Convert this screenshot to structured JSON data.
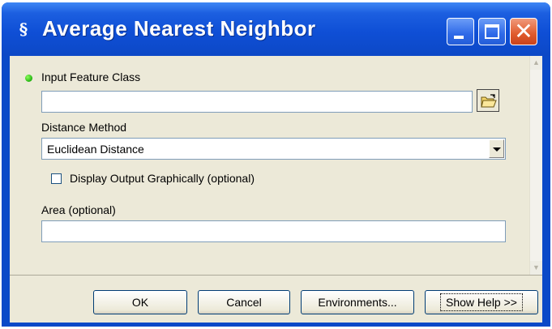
{
  "window": {
    "title": "Average Nearest Neighbor",
    "icon": "script-tool-icon",
    "controls": [
      "minimize-button",
      "maximize-button",
      "close-button"
    ]
  },
  "form": {
    "input_feature_class": {
      "label": "Input Feature Class",
      "value": "",
      "required_indicator": "green-dot",
      "browse_icon": "open-folder-icon"
    },
    "distance_method": {
      "label": "Distance Method",
      "value": "Euclidean Distance"
    },
    "display_output": {
      "label": "Display Output Graphically (optional)",
      "checked": false
    },
    "area": {
      "label": "Area (optional)",
      "value": ""
    }
  },
  "buttons": {
    "ok": "OK",
    "cancel": "Cancel",
    "environments": "Environments...",
    "show_help": "Show Help >>"
  },
  "colors": {
    "titlebar": "#0c48c6",
    "client": "#ece9d8",
    "close": "#e05a2c",
    "required_dot": "#23b212"
  }
}
